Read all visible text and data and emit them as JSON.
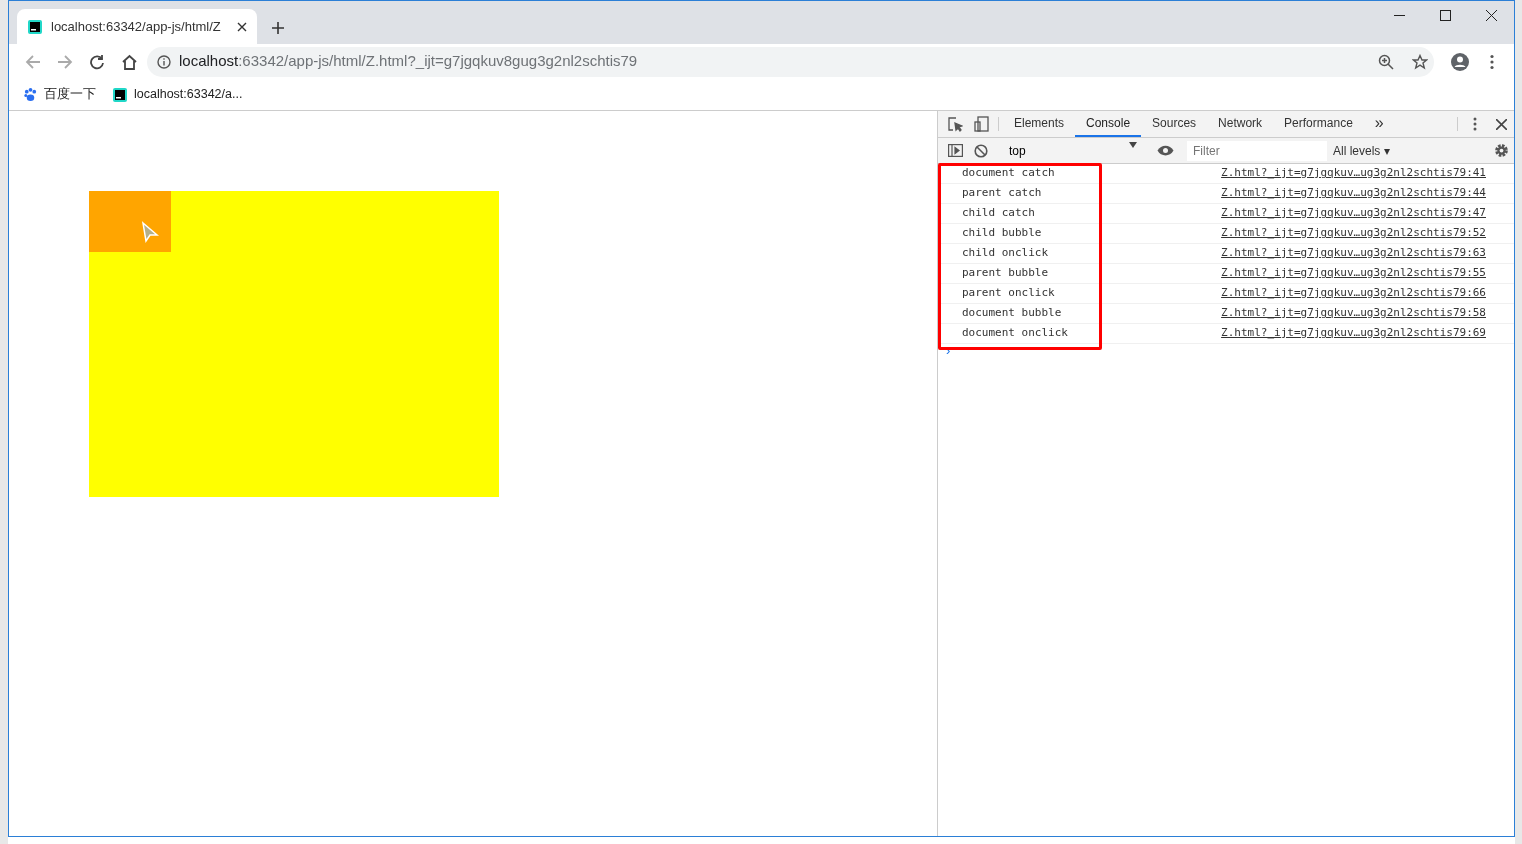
{
  "tab": {
    "title": "localhost:63342/app-js/html/Z",
    "selected": true
  },
  "address": {
    "host": "localhost",
    "rest": ":63342/app-js/html/Z.html?_ijt=g7jgqkuv8gug3g2nl2schtis79"
  },
  "bookmarks": [
    {
      "label": "百度一下",
      "kind": "paw"
    },
    {
      "label": "localhost:63342/a...",
      "kind": "ws"
    }
  ],
  "devtools": {
    "tabs": [
      {
        "label": "Elements",
        "selected": false
      },
      {
        "label": "Console",
        "selected": true
      },
      {
        "label": "Sources",
        "selected": false
      },
      {
        "label": "Network",
        "selected": false
      },
      {
        "label": "Performance",
        "selected": false
      }
    ],
    "more": "»",
    "context": "top",
    "filter": {
      "placeholder": "Filter"
    },
    "levels": "All levels ▾",
    "messages": [
      {
        "text": "document catch",
        "source": "Z.html?_ijt=g7jgqkuv…ug3g2nl2schtis79:41"
      },
      {
        "text": "parent catch",
        "source": "Z.html?_ijt=g7jgqkuv…ug3g2nl2schtis79:44"
      },
      {
        "text": "child catch",
        "source": "Z.html?_ijt=g7jgqkuv…ug3g2nl2schtis79:47"
      },
      {
        "text": "child bubble",
        "source": "Z.html?_ijt=g7jgqkuv…ug3g2nl2schtis79:52"
      },
      {
        "text": "child onclick",
        "source": "Z.html?_ijt=g7jgqkuv…ug3g2nl2schtis79:63"
      },
      {
        "text": "parent bubble",
        "source": "Z.html?_ijt=g7jgqkuv…ug3g2nl2schtis79:55"
      },
      {
        "text": "parent onclick",
        "source": "Z.html?_ijt=g7jgqkuv…ug3g2nl2schtis79:66"
      },
      {
        "text": "document bubble",
        "source": "Z.html?_ijt=g7jgqkuv…ug3g2nl2schtis79:58"
      },
      {
        "text": "document onclick",
        "source": "Z.html?_ijt=g7jgqkuv…ug3g2nl2schtis79:69"
      }
    ],
    "prompt": "›"
  }
}
